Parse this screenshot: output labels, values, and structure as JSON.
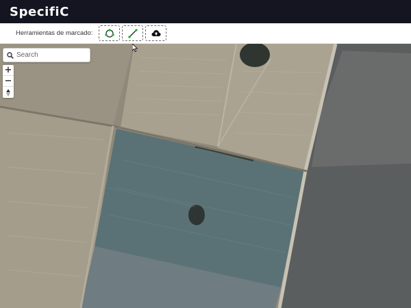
{
  "app": {
    "title": "SpecifiC"
  },
  "toolbar": {
    "label": "Herramientas de marcado:",
    "tools": [
      {
        "icon": "polygon-draw-icon"
      },
      {
        "icon": "line-draw-icon"
      },
      {
        "icon": "cloud-upload-icon"
      }
    ]
  },
  "map": {
    "search": {
      "placeholder": "Search",
      "value": ""
    },
    "zoom_in_label": "+",
    "zoom_out_label": "−",
    "compass_icon": "compass-north-icon"
  },
  "colors": {
    "topbar": "#141521",
    "accent_green": "#33b24f"
  }
}
